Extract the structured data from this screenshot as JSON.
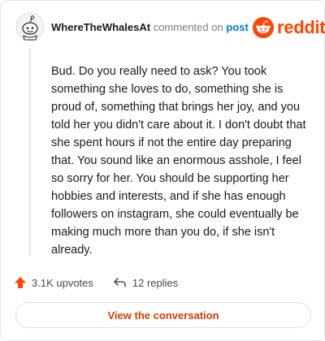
{
  "comment": {
    "username": "WhereTheWhalesAt",
    "commented_on": "commented on",
    "post_link": "post",
    "avatar_icon": "reddit-snoo-avatar-icon",
    "body": "Bud. Do you really need to ask? You took something she loves to do, something she is proud of, something that brings her joy, and you told her you didn't care about it. I don't doubt that she spent hours if not the entire day preparing that. You sound like an enormous asshole, I feel so sorry for her. You should be supporting her hobbies and interests, and if she has enough followers on instagram, she could eventually be making much more than you do, if she isn't already."
  },
  "brand": {
    "name": "reddit",
    "color": "#ff4500"
  },
  "actions": {
    "upvotes": "3.1K upvotes",
    "replies": "12 replies",
    "upvote_icon": "upvote-arrow-icon",
    "reply_icon": "reply-arrow-icon"
  },
  "cta": {
    "label": "View the conversation"
  },
  "colors": {
    "link": "#0079d3",
    "cta_text": "#d93a00",
    "upvote": "#ff4500"
  }
}
